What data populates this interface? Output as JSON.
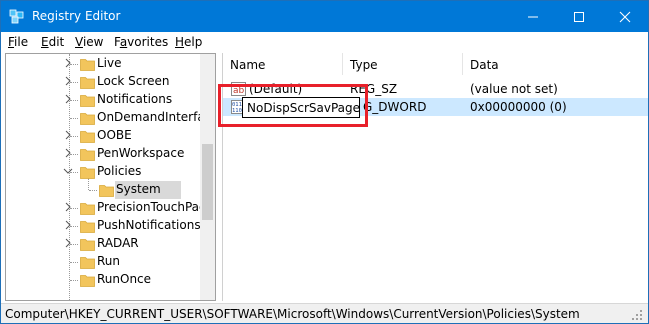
{
  "window": {
    "title": "Registry Editor"
  },
  "menu": {
    "file": "ile",
    "file_acc": "F",
    "edit": "dit",
    "edit_acc": "E",
    "view": "iew",
    "view_acc": "V",
    "favorites_pre": "F",
    "favorites_acc": "a",
    "favorites_post": "vorites",
    "help": "elp",
    "help_acc": "H"
  },
  "tree": {
    "items": [
      {
        "label": "Live",
        "expander": "chevron-right"
      },
      {
        "label": "Lock Screen",
        "expander": "chevron-right"
      },
      {
        "label": "Notifications",
        "expander": "chevron-right"
      },
      {
        "label": "OnDemandInterfac",
        "expander": "none"
      },
      {
        "label": "OOBE",
        "expander": "chevron-right"
      },
      {
        "label": "PenWorkspace",
        "expander": "chevron-right"
      },
      {
        "label": "Policies",
        "expander": "chevron-down"
      },
      {
        "label": "System",
        "expander": "none",
        "selected": true
      },
      {
        "label": "PrecisionTouchPad",
        "expander": "chevron-right"
      },
      {
        "label": "PushNotifications",
        "expander": "chevron-right"
      },
      {
        "label": "RADAR",
        "expander": "chevron-right"
      },
      {
        "label": "Run",
        "expander": "none"
      },
      {
        "label": "RunOnce",
        "expander": "none"
      }
    ]
  },
  "list": {
    "headers": {
      "name": "Name",
      "type": "Type",
      "data": "Data"
    },
    "rows": [
      {
        "name": "(Default)",
        "type": "REG_SZ",
        "data": "(value not set)",
        "icon": "string-value-icon"
      },
      {
        "name": "",
        "type": "REG_DWORD",
        "data": "0x00000000 (0)",
        "icon": "dword-value-icon",
        "selected": true
      }
    ],
    "rename_value": "NoDispScrSavPage",
    "type_partial_row2": "G_DWORD"
  },
  "status": {
    "path": "Computer\\HKEY_CURRENT_USER\\SOFTWARE\\Microsoft\\Windows\\CurrentVersion\\Policies\\System"
  },
  "colors": {
    "titlebar": "#0078d7",
    "selection": "#cce8ff",
    "highlight": "#e8202a",
    "folder": "#f2c55c"
  }
}
